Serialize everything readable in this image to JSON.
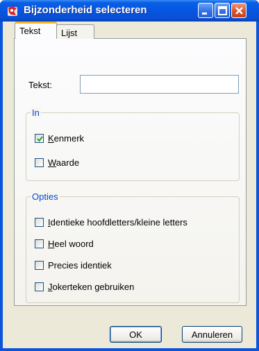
{
  "window": {
    "title": "Bijzonderheid selecteren",
    "icons": [
      "app-icon",
      "minimize-icon",
      "maximize-icon",
      "close-icon"
    ]
  },
  "tabs": [
    {
      "label": "Tekst",
      "selected": true
    },
    {
      "label": "Lijst",
      "selected": false
    }
  ],
  "search": {
    "label": "Tekst:",
    "value": "",
    "placeholder": ""
  },
  "group_in": {
    "legend": "In",
    "options": [
      {
        "pre": "",
        "ul": "K",
        "post": "enmerk",
        "checked": true
      },
      {
        "pre": "",
        "ul": "W",
        "post": "aarde",
        "checked": false
      }
    ]
  },
  "group_opties": {
    "legend": "Opties",
    "options": [
      {
        "pre": "",
        "ul": "I",
        "post": "dentieke hoofdletters/kleine letters",
        "checked": false
      },
      {
        "pre": "",
        "ul": "H",
        "post": "eel woord",
        "checked": false
      },
      {
        "pre": "",
        "ul": "",
        "post": "Precies identiek",
        "checked": false
      },
      {
        "pre": "",
        "ul": "J",
        "post": "okerteken gebruiken",
        "checked": false
      }
    ]
  },
  "buttons": {
    "ok": "OK",
    "cancel": "Annuleren"
  },
  "colors": {
    "title_bar": "#0556e0",
    "accent_tab": "#f6b32a",
    "legend": "#0046d5",
    "close": "#d9532e"
  }
}
